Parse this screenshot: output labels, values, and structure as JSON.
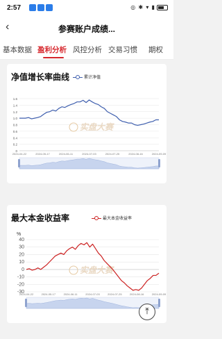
{
  "status_bar": {
    "time": "2:57",
    "right_icons": "◎ ✱ ▾ ▮"
  },
  "header": {
    "back_icon": "‹",
    "title": "参赛账户成绩..."
  },
  "tabs": [
    {
      "label": "基本数据",
      "active": false
    },
    {
      "label": "盈利分析",
      "active": true
    },
    {
      "label": "风控分析",
      "active": false
    },
    {
      "label": "交易习惯",
      "active": false
    },
    {
      "label": "期权",
      "active": false
    }
  ],
  "watermark": "实盘大赛",
  "fab_icon": "⤒",
  "chart_data": [
    {
      "type": "line",
      "title": "净值增长率曲线",
      "series": [
        {
          "name": "累计净值",
          "color": "#3f5fae",
          "values": [
            1.0,
            1.0,
            1.0,
            1.02,
            0.98,
            1.0,
            1.02,
            1.05,
            1.12,
            1.18,
            1.2,
            1.25,
            1.22,
            1.3,
            1.35,
            1.33,
            1.38,
            1.42,
            1.45,
            1.5,
            1.5,
            1.55,
            1.48,
            1.56,
            1.5,
            1.45,
            1.42,
            1.35,
            1.3,
            1.2,
            1.15,
            1.1,
            1.05,
            0.95,
            0.9,
            0.88,
            0.85,
            0.85,
            0.8,
            0.78,
            0.8,
            0.82,
            0.85,
            0.88,
            0.9,
            0.95,
            0.95
          ]
        }
      ],
      "xlabels": [
        "2024-04-22",
        "2024-05-17",
        "2024-06-11",
        "2024-07-03",
        "2024-07-25",
        "2024-08-16",
        "2024-09-09"
      ],
      "yticks": [
        "1.6",
        "1.4",
        "1.2",
        "1.0",
        "0.8",
        "0.6",
        "0.4",
        "0.2",
        "0"
      ],
      "ylim": [
        0,
        1.6
      ],
      "grid": true
    },
    {
      "type": "line",
      "title": "最大本金收益率",
      "yunit": "%",
      "series": [
        {
          "name": "最大本金收益率",
          "color": "#cc2222",
          "values": [
            0,
            1,
            -1,
            0,
            2,
            0,
            3,
            6,
            10,
            14,
            18,
            20,
            22,
            20,
            25,
            28,
            30,
            27,
            32,
            35,
            33,
            36,
            30,
            34,
            28,
            22,
            18,
            12,
            8,
            4,
            0,
            -5,
            -10,
            -15,
            -18,
            -22,
            -25,
            -28,
            -27,
            -28,
            -25,
            -20,
            -15,
            -12,
            -8,
            -8,
            -5
          ]
        }
      ],
      "xlabels": [
        "2024-04-22",
        "2024-05-17",
        "2024-06-11",
        "2024-07-03",
        "2024-07-25",
        "2024-08-16",
        "2024-09-09"
      ],
      "yticks": [
        "40",
        "30",
        "20",
        "10",
        "0",
        "-10",
        "-20",
        "-30"
      ],
      "ylim": [
        -30,
        40
      ],
      "grid": true
    }
  ]
}
